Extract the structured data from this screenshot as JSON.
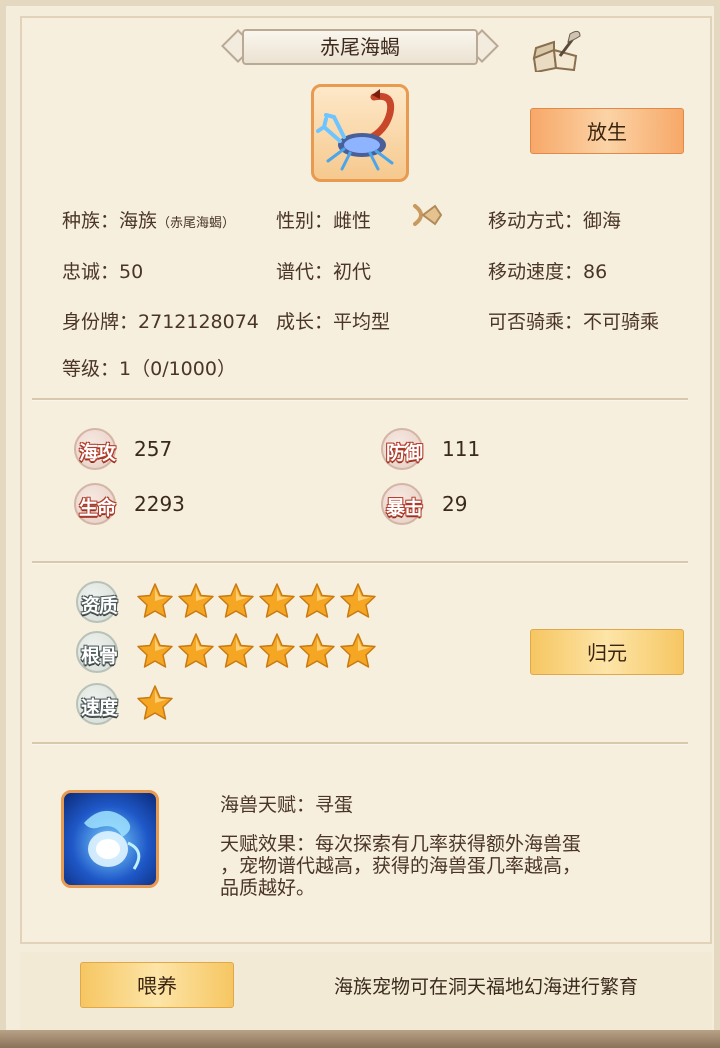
{
  "title": "赤尾海蝎",
  "buttons": {
    "release": "放生",
    "reset": "归元",
    "feed": "喂养"
  },
  "info": {
    "race_label": "种族：",
    "race_value": "海族",
    "race_sub": "（赤尾海蝎）",
    "gender_label": "性别：",
    "gender_value": "雌性",
    "move_mode_label": "移动方式：",
    "move_mode_value": "御海",
    "loyalty_label": "忠诚：",
    "loyalty_value": "50",
    "generation_label": "谱代：",
    "generation_value": "初代",
    "move_speed_label": "移动速度：",
    "move_speed_value": "86",
    "id_label": "身份牌：",
    "id_value": "2712128074",
    "growth_label": "成长：",
    "growth_value": "平均型",
    "ride_label": "可否骑乘：",
    "ride_value": "不可骑乘",
    "level_label": "等级：",
    "level_value": "1（0/1000）"
  },
  "stats": {
    "attack": {
      "label": "海攻",
      "value": "257"
    },
    "defense": {
      "label": "防御",
      "value": "111"
    },
    "hp": {
      "label": "生命",
      "value": "2293"
    },
    "crit": {
      "label": "暴击",
      "value": "29"
    }
  },
  "qualities": [
    {
      "label": "资质",
      "stars": 6
    },
    {
      "label": "根骨",
      "stars": 6
    },
    {
      "label": "速度",
      "stars": 1
    }
  ],
  "skill": {
    "name": "海兽天赋：寻蛋",
    "desc": "天赋效果：每次探索有几率获得额外海兽蛋\n，宠物谱代越高，获得的海兽蛋几率越高，\n品质越好。"
  },
  "hint": "海族宠物可在洞天福地幻海进行繁育",
  "colors": {
    "star": "#f5a623",
    "release_button": "#f7a868",
    "gold_button": "#f6c662",
    "badge_red": "#b23c2a",
    "badge_gray": "#4d5a5a"
  },
  "icons": [
    "book-quill-icon",
    "scorpion-portrait",
    "arrow-icon",
    "star-icon",
    "egg-skill-icon"
  ]
}
